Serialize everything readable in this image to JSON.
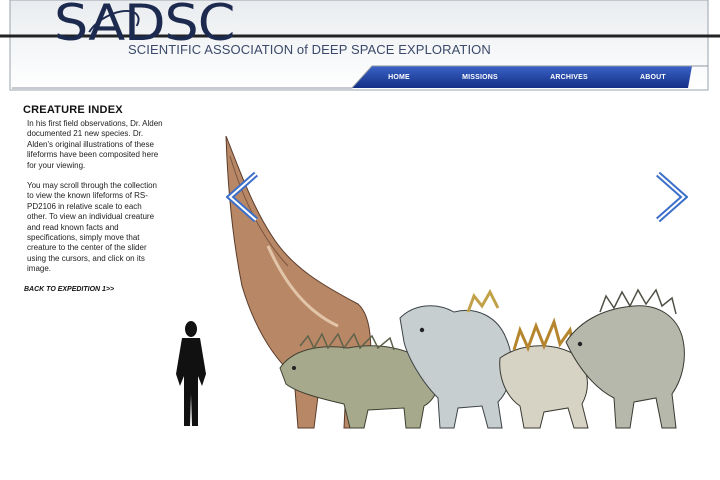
{
  "header": {
    "logo_text": "SADSC",
    "org_name": "SCIENTIFIC ASSOCIATION of DEEP SPACE EXPLORATION",
    "nav": [
      {
        "label": "HOME"
      },
      {
        "label": "MISSIONS"
      },
      {
        "label": "ARCHIVES"
      },
      {
        "label": "ABOUT"
      }
    ],
    "nav_color": "#1e3f9c",
    "logo_color": "#1d2a4f"
  },
  "sidebar": {
    "title": "CREATURE INDEX",
    "paragraph_1": "In his first field observations, Dr. Alden documented 21 new species. Dr. Alden's original illustrations of these lifeforms have been composited here for your viewing.",
    "paragraph_2": "You may scroll through the collection to view the known lifeforms of RS-PD2106 in relative scale to each other. To view an individual creature and read known facts and specifications, simply move that creature to the center of the slider using the cursors, and click on its image.",
    "back_link": "BACK TO EXPEDITION 1>>"
  },
  "gallery": {
    "prev_icon": "chevron-left-icon",
    "next_icon": "chevron-right-icon",
    "arrow_color": "#3b6fc9",
    "creatures": [
      "human-silhouette",
      "long-neck-creature",
      "spiky-lizard-creature",
      "horned-beast-creature",
      "spined-crawler-creature",
      "armored-reptile-creature"
    ]
  }
}
